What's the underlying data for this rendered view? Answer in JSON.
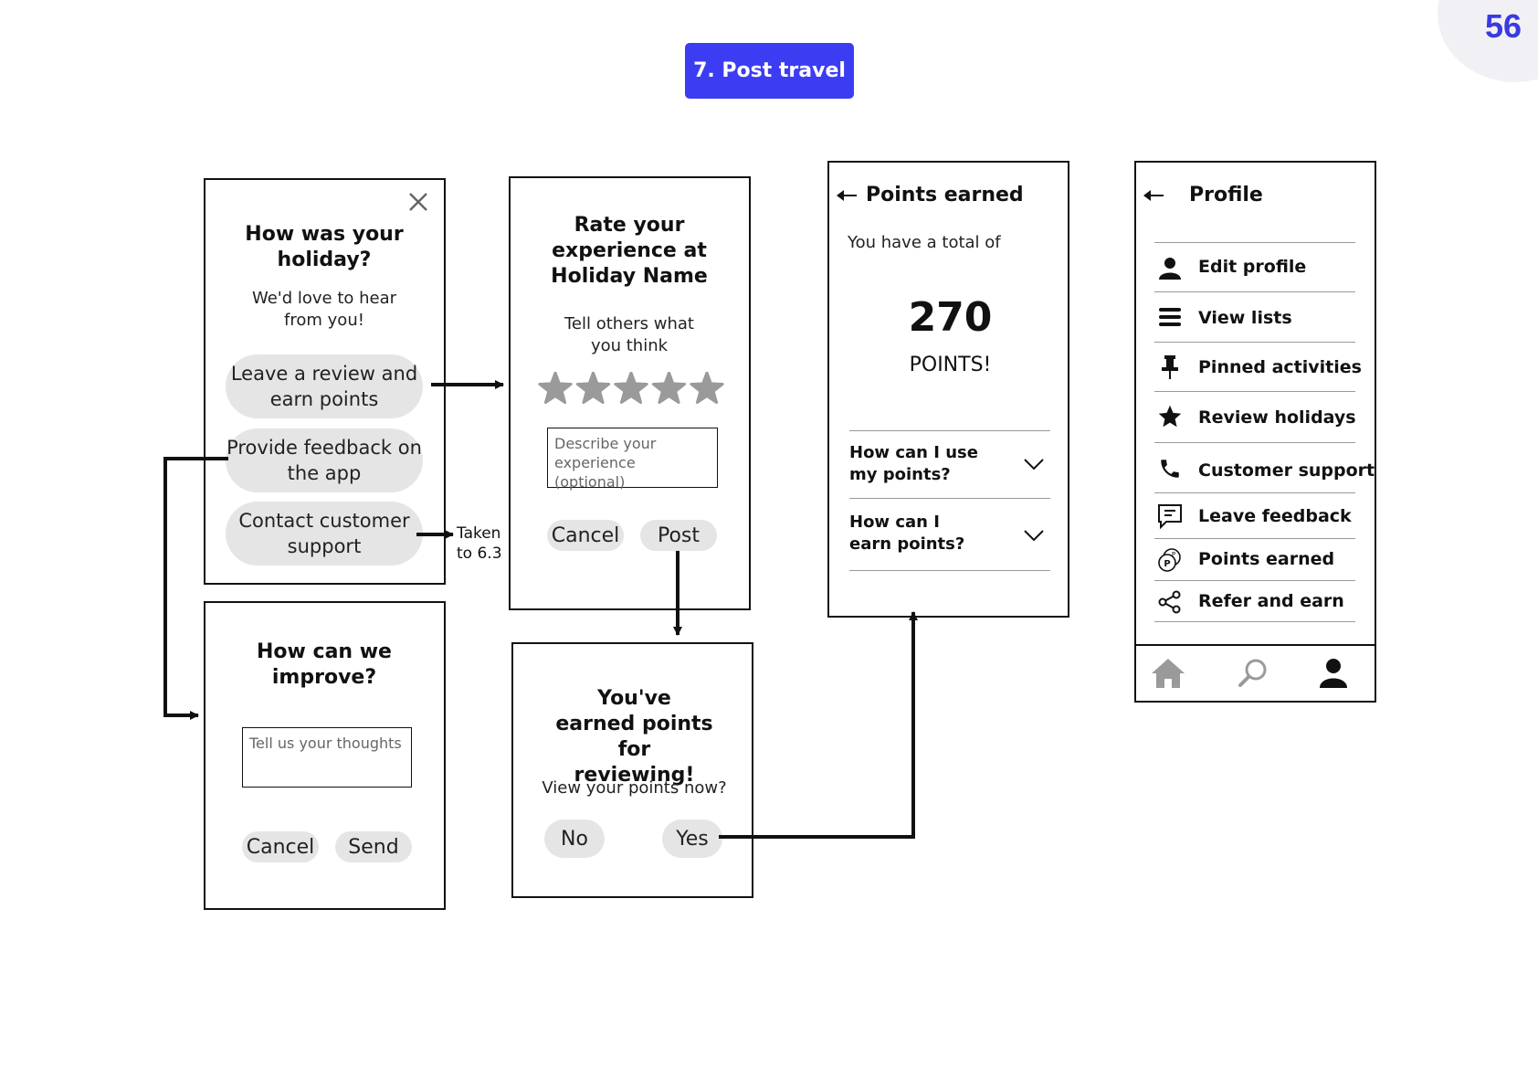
{
  "page_number": "56",
  "section_title": "7. Post travel",
  "screen_how_was": {
    "close_icon": "close-icon",
    "title": "How was your holiday?",
    "subtitle": "We'd love to hear from you!",
    "options": [
      "Leave a review and earn points",
      "Provide feedback on the app",
      "Contact customer support"
    ]
  },
  "contact_note": "Taken to 6.3",
  "screen_improve": {
    "title": "How can we improve?",
    "placeholder": "Tell us your thoughts",
    "cancel": "Cancel",
    "send": "Send"
  },
  "screen_rate": {
    "title": "Rate your experience at Holiday Name",
    "subtitle": "Tell others what you think",
    "star_count": 5,
    "placeholder": "Describe your experience (optional)",
    "cancel": "Cancel",
    "post": "Post"
  },
  "screen_earned": {
    "title": "You've earned points for reviewing!",
    "subtitle": "View your points now?",
    "no": "No",
    "yes": "Yes"
  },
  "screen_points": {
    "title": "Points earned",
    "subtitle": "You have a total of",
    "points": "270",
    "points_label": "POINTS!",
    "faq": [
      "How can I use my points?",
      "How can I earn points?"
    ]
  },
  "screen_profile": {
    "title": "Profile",
    "menu": [
      {
        "label": "Edit profile",
        "icon": "person-icon"
      },
      {
        "label": "View lists",
        "icon": "list-icon"
      },
      {
        "label": "Pinned activities",
        "icon": "pin-icon"
      },
      {
        "label": "Review holidays",
        "icon": "star-icon"
      },
      {
        "label": "Customer support",
        "icon": "phone-icon"
      },
      {
        "label": "Leave feedback",
        "icon": "feedback-icon"
      },
      {
        "label": "Points earned",
        "icon": "points-icon"
      },
      {
        "label": "Refer and earn",
        "icon": "share-icon"
      }
    ],
    "nav": [
      "home-icon",
      "search-icon",
      "profile-icon"
    ]
  }
}
